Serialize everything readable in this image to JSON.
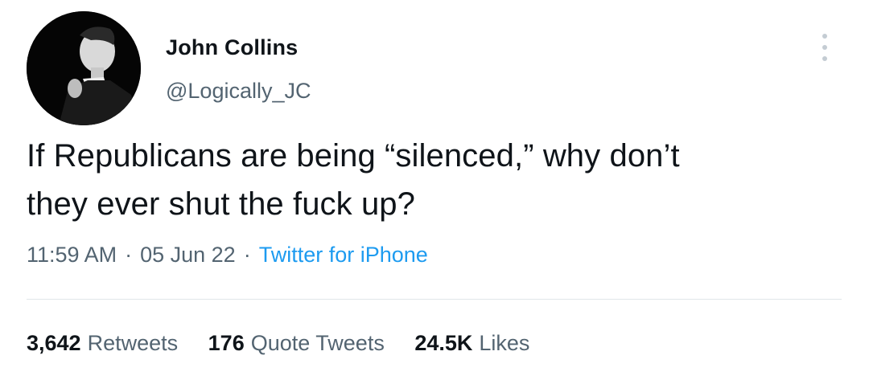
{
  "author": {
    "display_name": "John Collins",
    "handle": "@Logically_JC",
    "avatar_icon": "profile-photo-bw"
  },
  "tweet": {
    "text_line1": "If Republicans are being “silenced,” why don’t",
    "text_line2": "they ever shut the fuck up?"
  },
  "meta": {
    "time": "11:59 AM",
    "date": "05 Jun 22",
    "separator": "·",
    "source": "Twitter for iPhone"
  },
  "stats": {
    "retweets_count": "3,642",
    "retweets_label": "Retweets",
    "quotes_count": "176",
    "quotes_label": "Quote Tweets",
    "likes_count": "24.5K",
    "likes_label": "Likes"
  },
  "colors": {
    "text_primary": "#0f1419",
    "text_secondary": "#536471",
    "link": "#1d9bf0",
    "divider": "#e1e6ea"
  },
  "icons": {
    "more": "more-vertical-icon"
  }
}
